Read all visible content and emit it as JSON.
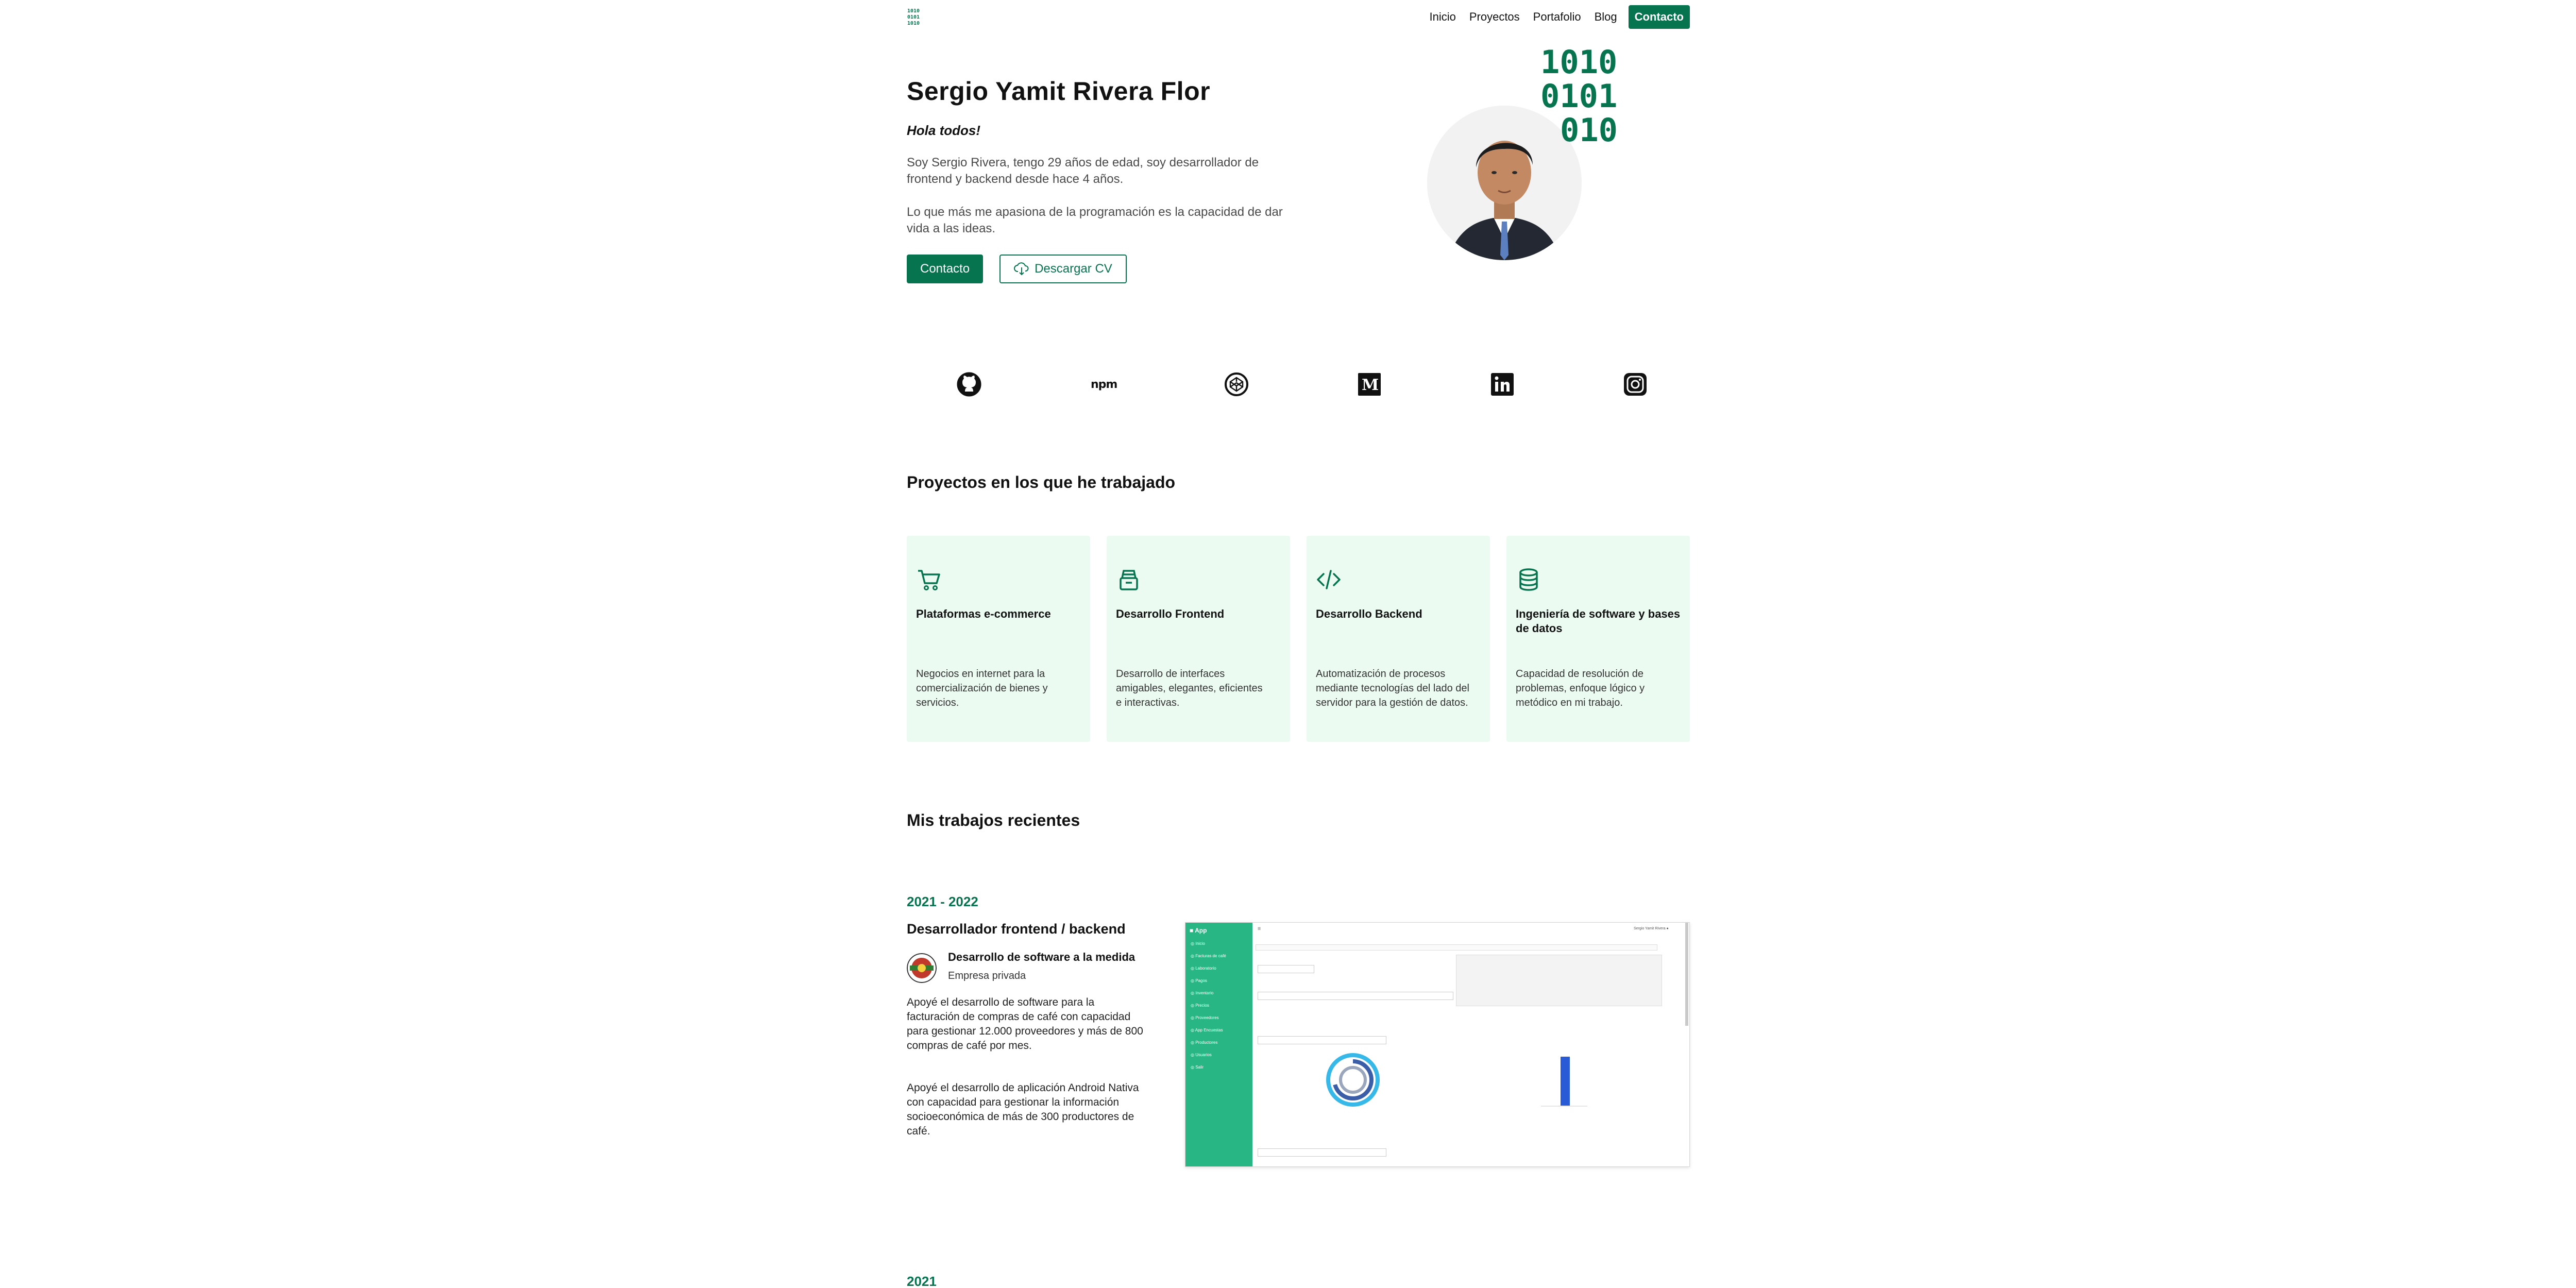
{
  "nav": {
    "items": [
      "Inicio",
      "Proyectos",
      "Portafolio",
      "Blog"
    ],
    "contact": "Contacto"
  },
  "hero": {
    "name": "Sergio Yamit Rivera Flor",
    "greeting": "Hola todos!",
    "p1": "Soy Sergio Rivera, tengo 29 años de edad, soy desarrollador de frontend y backend desde hace 4 años.",
    "p2": "Lo que más me apasiona de la programación es la capacidad de dar vida a las ideas.",
    "btn_contact": "Contacto",
    "btn_cv": "Descargar CV",
    "binary_rows": [
      "1010",
      "0101",
      "010"
    ]
  },
  "social": [
    "github-icon",
    "npm-icon",
    "codepen-icon",
    "medium-icon",
    "linkedin-icon",
    "instagram-icon"
  ],
  "projects": {
    "title": "Proyectos en los que he trabajado",
    "cards": [
      {
        "icon": "cart-icon",
        "title": "Plataformas e-commerce",
        "desc": "Negocios en internet para la comercialización de bienes y servicios."
      },
      {
        "icon": "archive-icon",
        "title": "Desarrollo Frontend",
        "desc": "Desarrollo de interfaces amigables, elegantes, eficientes e interactivas."
      },
      {
        "icon": "code-icon",
        "title": "Desarrollo Backend",
        "desc": "Automatización de procesos mediante tecnologías del lado del servidor para la gestión de datos."
      },
      {
        "icon": "database-icon",
        "title": "Ingeniería de software y bases de datos",
        "desc": "Capacidad de resolución de problemas, enfoque lógico y metódico en mi trabajo."
      }
    ]
  },
  "work": {
    "title": "Mis trabajos recientes",
    "jobs": [
      {
        "years": "2021 - 2022",
        "role": "Desarrollador frontend / backend",
        "company": "Desarrollo de software a la medida",
        "company_type": "Empresa privada",
        "p1": "Apoyé el desarrollo de software para la facturación de compras de café con capacidad para gestionar 12.000 proveedores y más de 800 compras de café por mes.",
        "p2": "Apoyé el desarrollo de aplicación Android Nativa con capacidad para gestionar la información socioeconómica de más de 300 productores de café."
      },
      {
        "years": "2021"
      }
    ]
  },
  "colors": {
    "accent": "#06754f",
    "card_bg": "#ebfbf2",
    "sidebar": "#27b684"
  }
}
